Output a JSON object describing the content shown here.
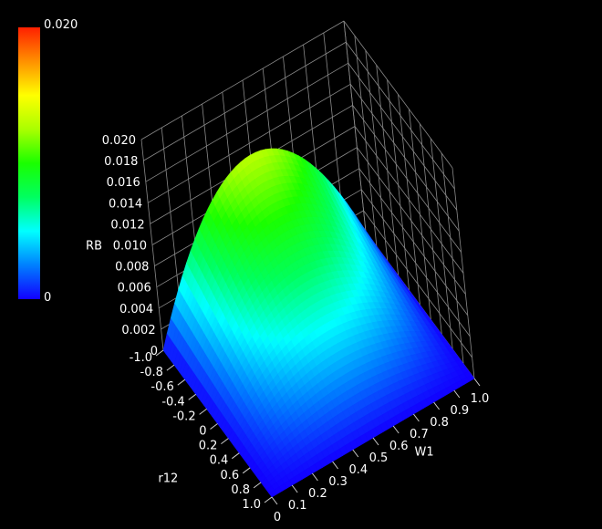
{
  "chart_data": {
    "type": "surface3d",
    "background": "#000000",
    "zlabel": "RB",
    "xlabel": "r12",
    "ylabel": "W1",
    "x_range": [
      -1.0,
      1.0
    ],
    "y_range": [
      0,
      1.0
    ],
    "z_range": [
      0,
      0.02
    ],
    "x_ticks": [
      "-1.0",
      "-0.8",
      "-0.6",
      "-0.4",
      "-0.2",
      "0",
      "0.2",
      "0.4",
      "0.6",
      "0.8",
      "1.0"
    ],
    "y_ticks": [
      "0",
      "0.1",
      "0.2",
      "0.3",
      "0.4",
      "0.5",
      "0.6",
      "0.7",
      "0.8",
      "0.9",
      "1.0"
    ],
    "z_ticks": [
      "0",
      "0.002",
      "0.004",
      "0.006",
      "0.008",
      "0.010",
      "0.012",
      "0.014",
      "0.016",
      "0.018",
      "0.020"
    ],
    "colorbar": {
      "min_label": "0",
      "max_label": "0.020",
      "colors": [
        "#1200ff",
        "#0080ff",
        "#00ffff",
        "#00ff60",
        "#1aff00",
        "#aaff00",
        "#ffff00",
        "#ff9000",
        "#ff2000"
      ]
    },
    "surface": {
      "description": "RB = 0.0129 * (1 - r12)/2 * 4*W1*(1 - W1)",
      "peak": {
        "r12": -1.0,
        "W1": 0.5,
        "RB": 0.0129
      },
      "corners": [
        {
          "r12": -1.0,
          "W1": 0,
          "RB": 0
        },
        {
          "r12": -1.0,
          "W1": 1.0,
          "RB": 0
        },
        {
          "r12": 1.0,
          "W1": 0,
          "RB": 0
        },
        {
          "r12": 1.0,
          "W1": 1.0,
          "RB": 0
        }
      ]
    },
    "grid": true
  }
}
